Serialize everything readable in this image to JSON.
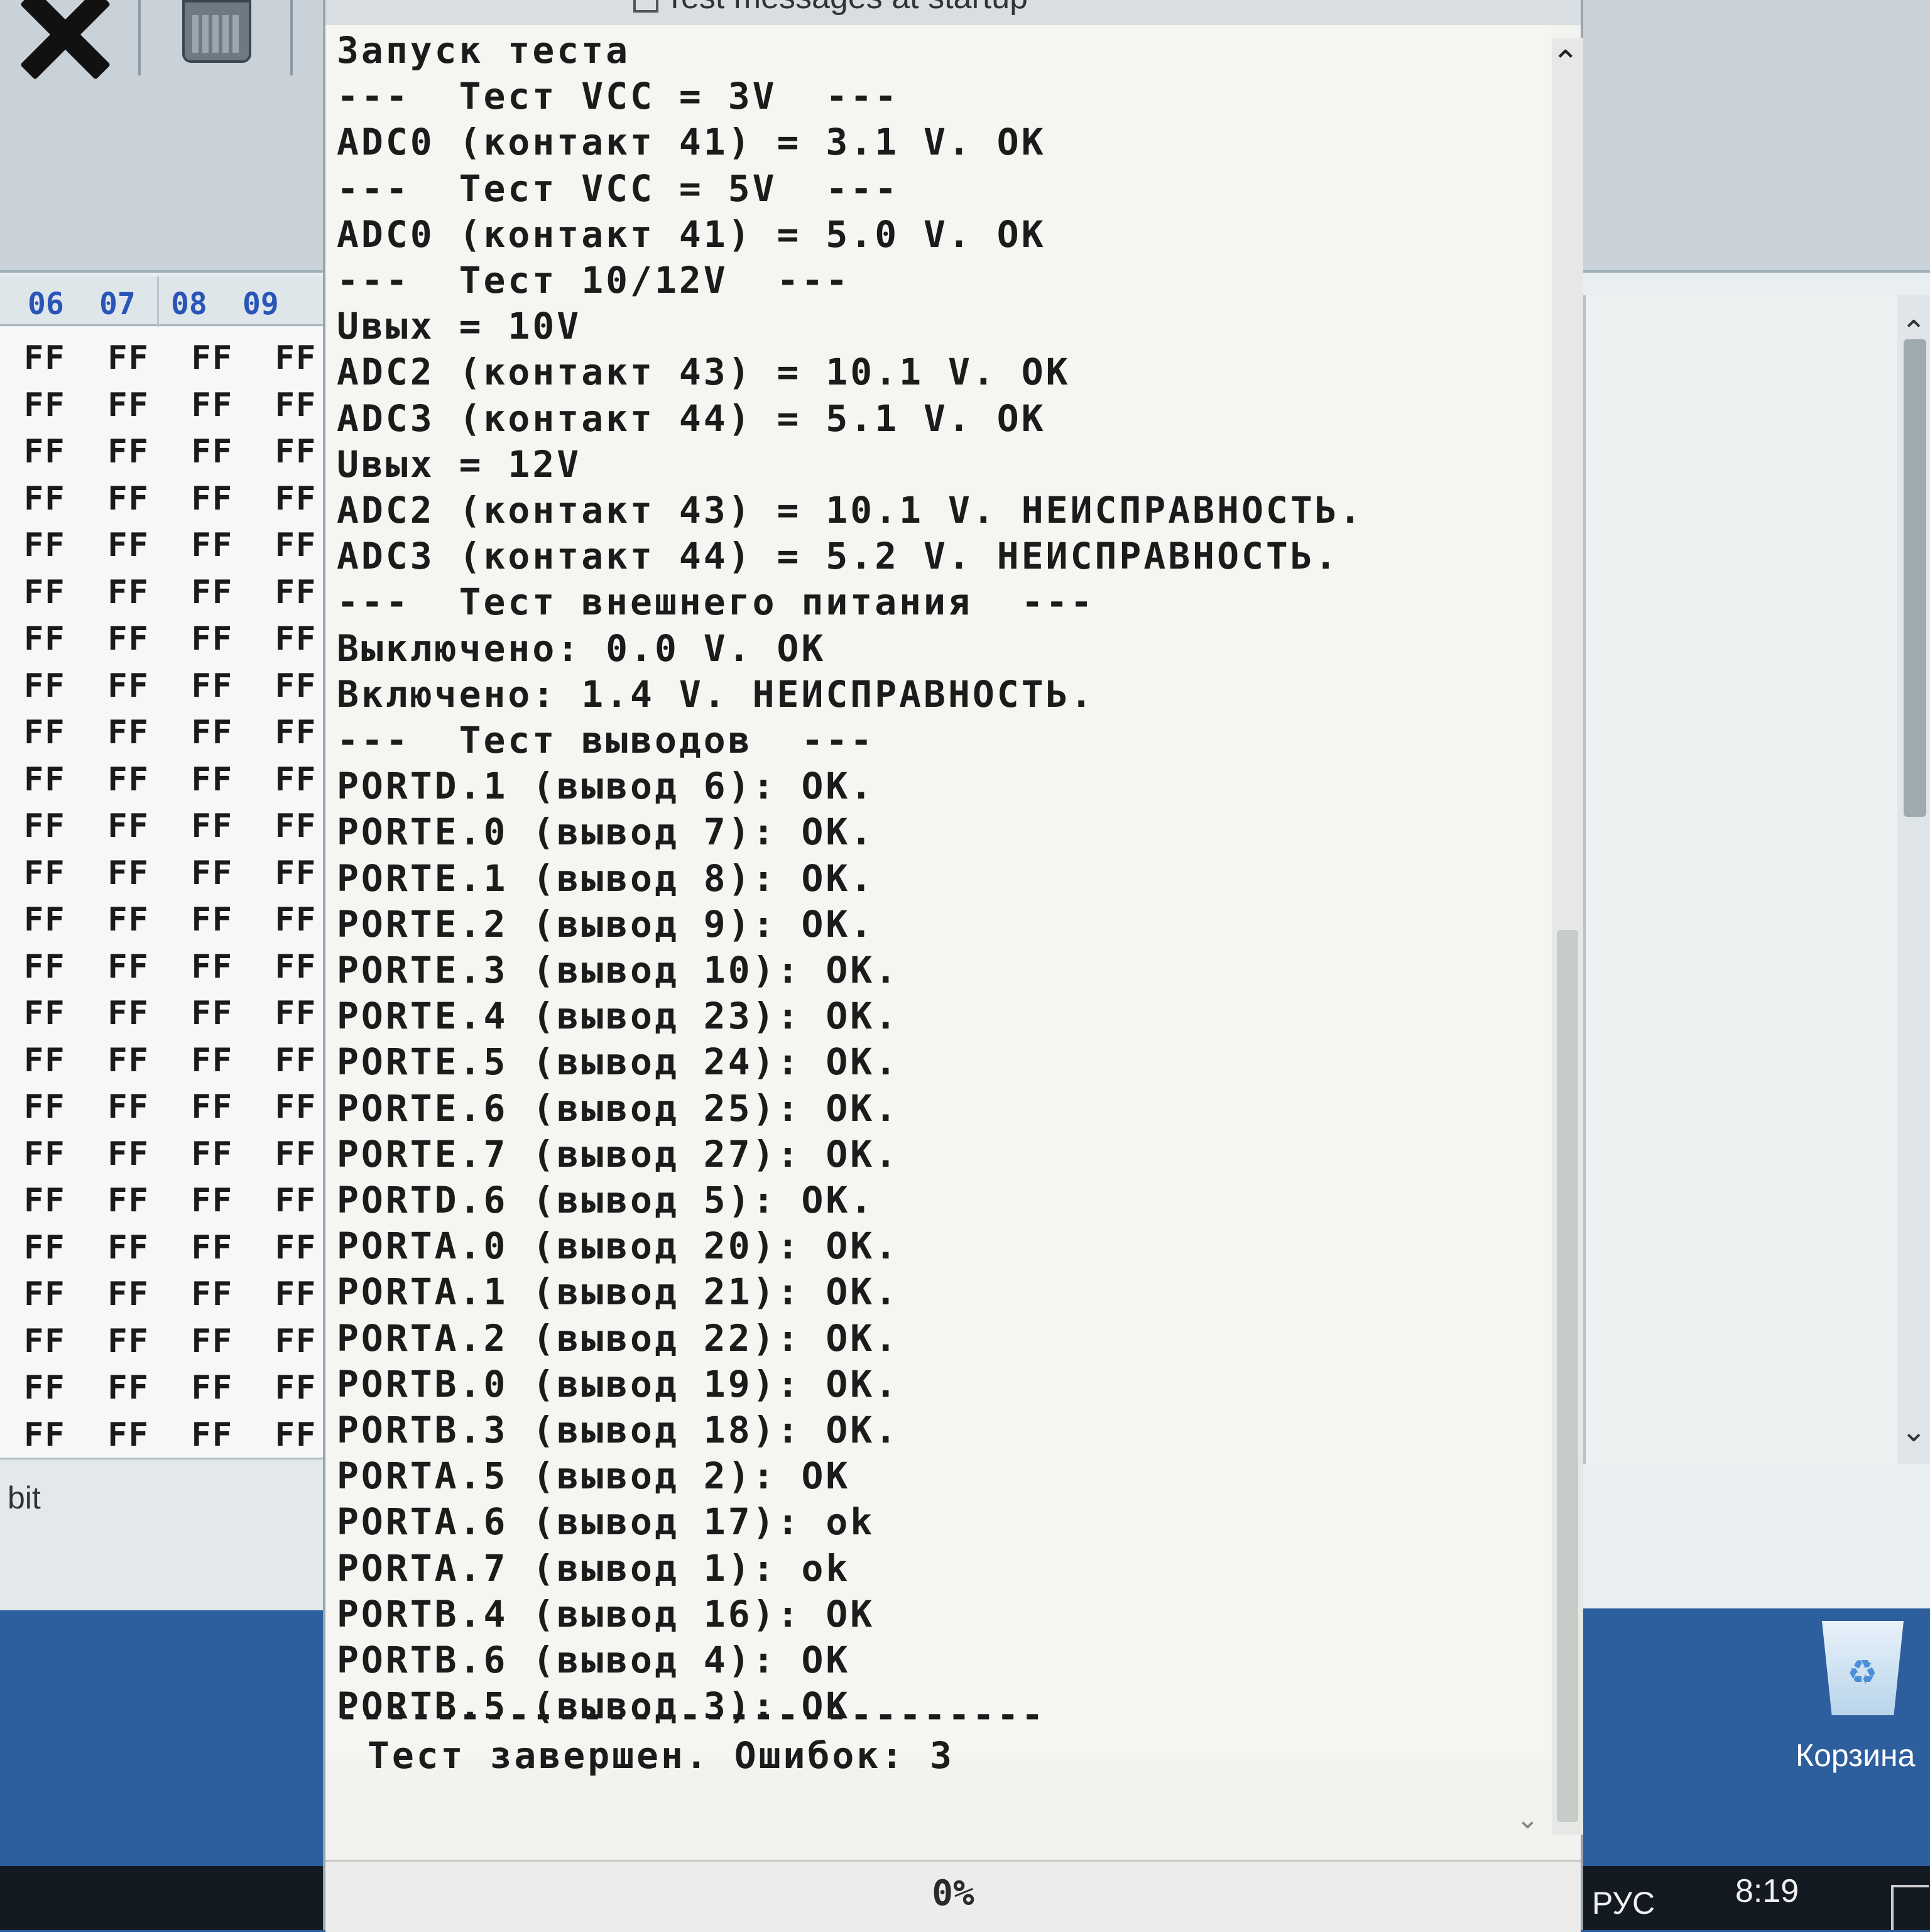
{
  "hex_editor": {
    "columns": [
      "06",
      "07",
      "08",
      "09"
    ],
    "row_value": "FF  FF  FF  FF",
    "row_count": 24,
    "status": "bit"
  },
  "test_window": {
    "title": "Test messages at startup",
    "log_lines": [
      "Запуск теста",
      "---  Тест VCC = 3V  ---",
      "ADC0 (контакт 41) = 3.1 V. OK",
      "---  Тест VCC = 5V  ---",
      "ADC0 (контакт 41) = 5.0 V. OK",
      "---  Тест 10/12V  ---",
      "Uвых = 10V",
      "ADC2 (контакт 43) = 10.1 V. OK",
      "ADC3 (контакт 44) = 5.1 V. OK",
      "Uвых = 12V",
      "ADC2 (контакт 43) = 10.1 V. НЕИСПРАВНОСТЬ.",
      "ADC3 (контакт 44) = 5.2 V. НЕИСПРАВНОСТЬ.",
      "---  Тест внешнего питания  ---",
      "Выключено: 0.0 V. OK",
      "Включено: 1.4 V. НЕИСПРАВНОСТЬ.",
      "---  Тест выводов  ---",
      "PORTD.1 (вывод 6): OK.",
      "PORTE.0 (вывод 7): OK.",
      "PORTE.1 (вывод 8): OK.",
      "PORTE.2 (вывод 9): OK.",
      "PORTE.3 (вывод 10): OK.",
      "PORTE.4 (вывод 23): OK.",
      "PORTE.5 (вывод 24): OK.",
      "PORTE.6 (вывод 25): OK.",
      "PORTE.7 (вывод 27): OK.",
      "PORTD.6 (вывод 5): OK.",
      "PORTA.0 (вывод 20): OK.",
      "PORTA.1 (вывод 21): OK.",
      "PORTA.2 (вывод 22): OK.",
      "PORTB.0 (вывод 19): OK.",
      "PORTB.3 (вывод 18): OK.",
      "PORTA.5 (вывод 2): OK",
      "PORTA.6 (вывод 17): ok",
      "PORTA.7 (вывод 1): ok",
      "PORTB.4 (вывод 16): OK",
      "PORTB.6 (вывод 4): OK",
      "PORTB.5 (вывод 3): OK",
      "-----------------------------",
      " Тест завершен. Ошибок: 3"
    ],
    "progress": {
      "label": "0%",
      "value": 0
    }
  },
  "desktop": {
    "recycle_bin_label": "Корзина"
  },
  "taskbar": {
    "language": "РУС",
    "clock": "8:19"
  }
}
